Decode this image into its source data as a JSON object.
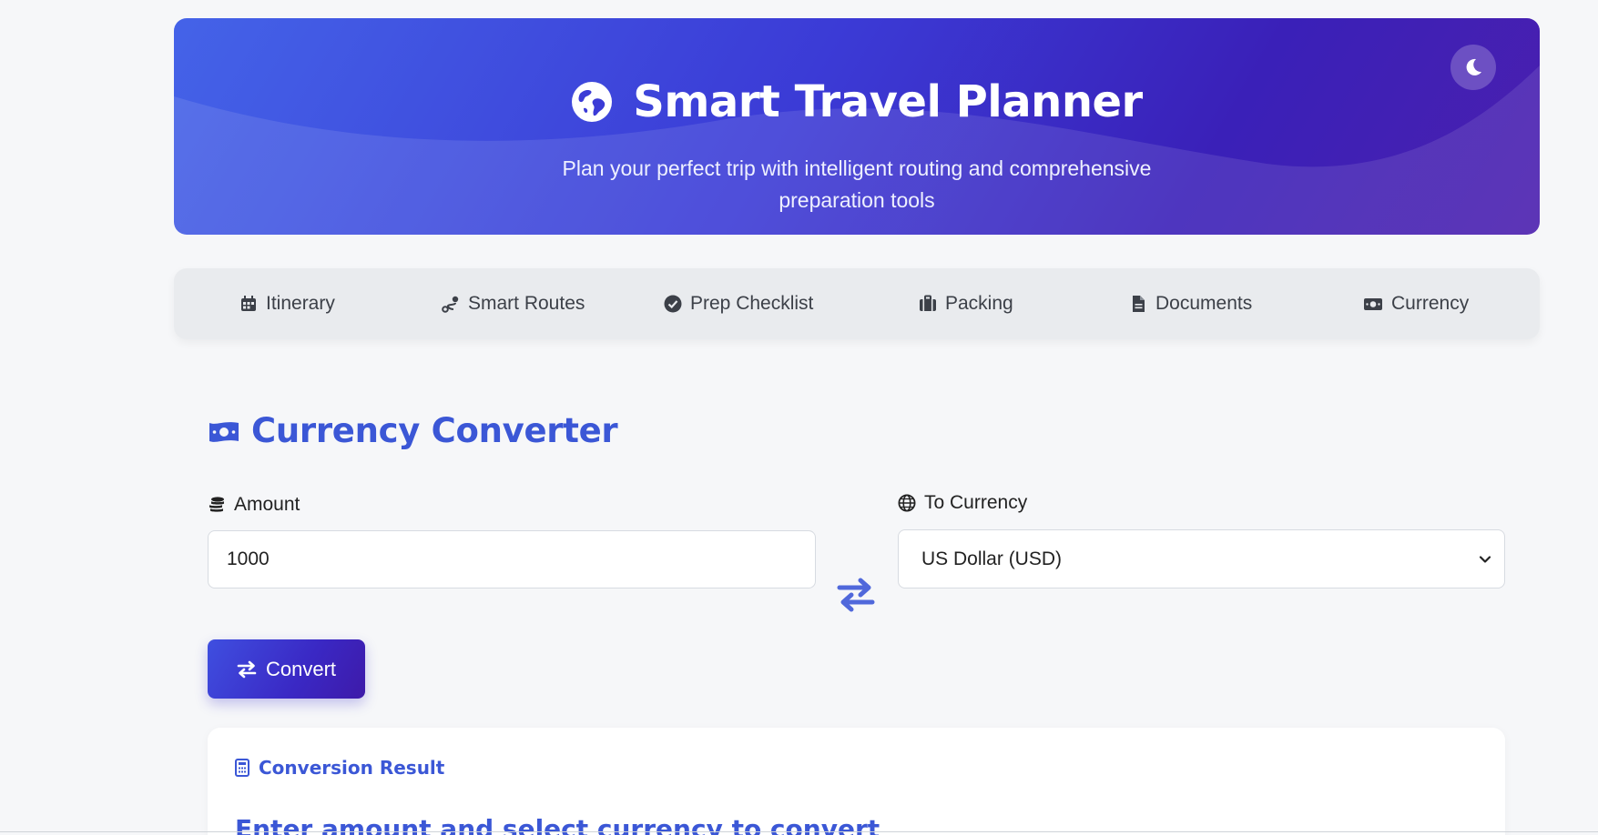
{
  "header": {
    "title": "Smart Travel Planner",
    "subtitle_line1": "Plan your perfect trip with intelligent routing and comprehensive",
    "subtitle_line2": "preparation tools"
  },
  "tabs": [
    {
      "label": "Itinerary",
      "icon": "calendar-icon"
    },
    {
      "label": "Smart Routes",
      "icon": "route-icon"
    },
    {
      "label": "Prep Checklist",
      "icon": "check-circle-icon"
    },
    {
      "label": "Packing",
      "icon": "suitcase-icon"
    },
    {
      "label": "Documents",
      "icon": "file-icon"
    },
    {
      "label": "Currency",
      "icon": "money-icon"
    }
  ],
  "converter": {
    "title": "Currency Converter",
    "amount_label": "Amount",
    "amount_value": "1000",
    "to_currency_label": "To Currency",
    "to_currency_selected": "US Dollar (USD)",
    "convert_label": "Convert"
  },
  "result": {
    "title": "Conversion Result",
    "message": "Enter amount and select currency to convert"
  },
  "colors": {
    "accent": "#3b57d6",
    "header_start": "#4463e8",
    "header_end": "#4b1fae",
    "tab_bg": "#e9ebee",
    "page_bg": "#f6f7f9"
  }
}
